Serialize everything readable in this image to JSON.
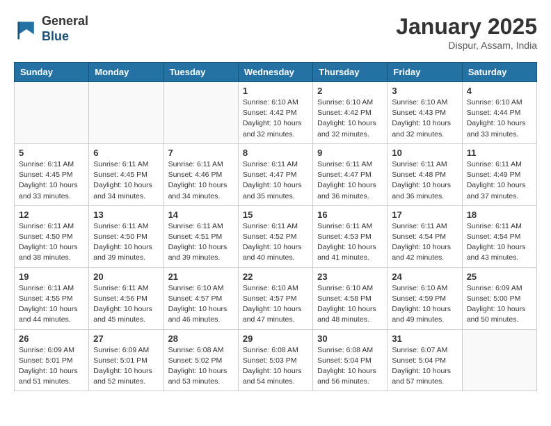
{
  "logo": {
    "general": "General",
    "blue": "Blue"
  },
  "title": "January 2025",
  "subtitle": "Dispur, Assam, India",
  "days_of_week": [
    "Sunday",
    "Monday",
    "Tuesday",
    "Wednesday",
    "Thursday",
    "Friday",
    "Saturday"
  ],
  "weeks": [
    [
      {
        "day": "",
        "info": ""
      },
      {
        "day": "",
        "info": ""
      },
      {
        "day": "",
        "info": ""
      },
      {
        "day": "1",
        "info": "Sunrise: 6:10 AM\nSunset: 4:42 PM\nDaylight: 10 hours\nand 32 minutes."
      },
      {
        "day": "2",
        "info": "Sunrise: 6:10 AM\nSunset: 4:42 PM\nDaylight: 10 hours\nand 32 minutes."
      },
      {
        "day": "3",
        "info": "Sunrise: 6:10 AM\nSunset: 4:43 PM\nDaylight: 10 hours\nand 32 minutes."
      },
      {
        "day": "4",
        "info": "Sunrise: 6:10 AM\nSunset: 4:44 PM\nDaylight: 10 hours\nand 33 minutes."
      }
    ],
    [
      {
        "day": "5",
        "info": "Sunrise: 6:11 AM\nSunset: 4:45 PM\nDaylight: 10 hours\nand 33 minutes."
      },
      {
        "day": "6",
        "info": "Sunrise: 6:11 AM\nSunset: 4:45 PM\nDaylight: 10 hours\nand 34 minutes."
      },
      {
        "day": "7",
        "info": "Sunrise: 6:11 AM\nSunset: 4:46 PM\nDaylight: 10 hours\nand 34 minutes."
      },
      {
        "day": "8",
        "info": "Sunrise: 6:11 AM\nSunset: 4:47 PM\nDaylight: 10 hours\nand 35 minutes."
      },
      {
        "day": "9",
        "info": "Sunrise: 6:11 AM\nSunset: 4:47 PM\nDaylight: 10 hours\nand 36 minutes."
      },
      {
        "day": "10",
        "info": "Sunrise: 6:11 AM\nSunset: 4:48 PM\nDaylight: 10 hours\nand 36 minutes."
      },
      {
        "day": "11",
        "info": "Sunrise: 6:11 AM\nSunset: 4:49 PM\nDaylight: 10 hours\nand 37 minutes."
      }
    ],
    [
      {
        "day": "12",
        "info": "Sunrise: 6:11 AM\nSunset: 4:50 PM\nDaylight: 10 hours\nand 38 minutes."
      },
      {
        "day": "13",
        "info": "Sunrise: 6:11 AM\nSunset: 4:50 PM\nDaylight: 10 hours\nand 39 minutes."
      },
      {
        "day": "14",
        "info": "Sunrise: 6:11 AM\nSunset: 4:51 PM\nDaylight: 10 hours\nand 39 minutes."
      },
      {
        "day": "15",
        "info": "Sunrise: 6:11 AM\nSunset: 4:52 PM\nDaylight: 10 hours\nand 40 minutes."
      },
      {
        "day": "16",
        "info": "Sunrise: 6:11 AM\nSunset: 4:53 PM\nDaylight: 10 hours\nand 41 minutes."
      },
      {
        "day": "17",
        "info": "Sunrise: 6:11 AM\nSunset: 4:54 PM\nDaylight: 10 hours\nand 42 minutes."
      },
      {
        "day": "18",
        "info": "Sunrise: 6:11 AM\nSunset: 4:54 PM\nDaylight: 10 hours\nand 43 minutes."
      }
    ],
    [
      {
        "day": "19",
        "info": "Sunrise: 6:11 AM\nSunset: 4:55 PM\nDaylight: 10 hours\nand 44 minutes."
      },
      {
        "day": "20",
        "info": "Sunrise: 6:11 AM\nSunset: 4:56 PM\nDaylight: 10 hours\nand 45 minutes."
      },
      {
        "day": "21",
        "info": "Sunrise: 6:10 AM\nSunset: 4:57 PM\nDaylight: 10 hours\nand 46 minutes."
      },
      {
        "day": "22",
        "info": "Sunrise: 6:10 AM\nSunset: 4:57 PM\nDaylight: 10 hours\nand 47 minutes."
      },
      {
        "day": "23",
        "info": "Sunrise: 6:10 AM\nSunset: 4:58 PM\nDaylight: 10 hours\nand 48 minutes."
      },
      {
        "day": "24",
        "info": "Sunrise: 6:10 AM\nSunset: 4:59 PM\nDaylight: 10 hours\nand 49 minutes."
      },
      {
        "day": "25",
        "info": "Sunrise: 6:09 AM\nSunset: 5:00 PM\nDaylight: 10 hours\nand 50 minutes."
      }
    ],
    [
      {
        "day": "26",
        "info": "Sunrise: 6:09 AM\nSunset: 5:01 PM\nDaylight: 10 hours\nand 51 minutes."
      },
      {
        "day": "27",
        "info": "Sunrise: 6:09 AM\nSunset: 5:01 PM\nDaylight: 10 hours\nand 52 minutes."
      },
      {
        "day": "28",
        "info": "Sunrise: 6:08 AM\nSunset: 5:02 PM\nDaylight: 10 hours\nand 53 minutes."
      },
      {
        "day": "29",
        "info": "Sunrise: 6:08 AM\nSunset: 5:03 PM\nDaylight: 10 hours\nand 54 minutes."
      },
      {
        "day": "30",
        "info": "Sunrise: 6:08 AM\nSunset: 5:04 PM\nDaylight: 10 hours\nand 56 minutes."
      },
      {
        "day": "31",
        "info": "Sunrise: 6:07 AM\nSunset: 5:04 PM\nDaylight: 10 hours\nand 57 minutes."
      },
      {
        "day": "",
        "info": ""
      }
    ]
  ]
}
